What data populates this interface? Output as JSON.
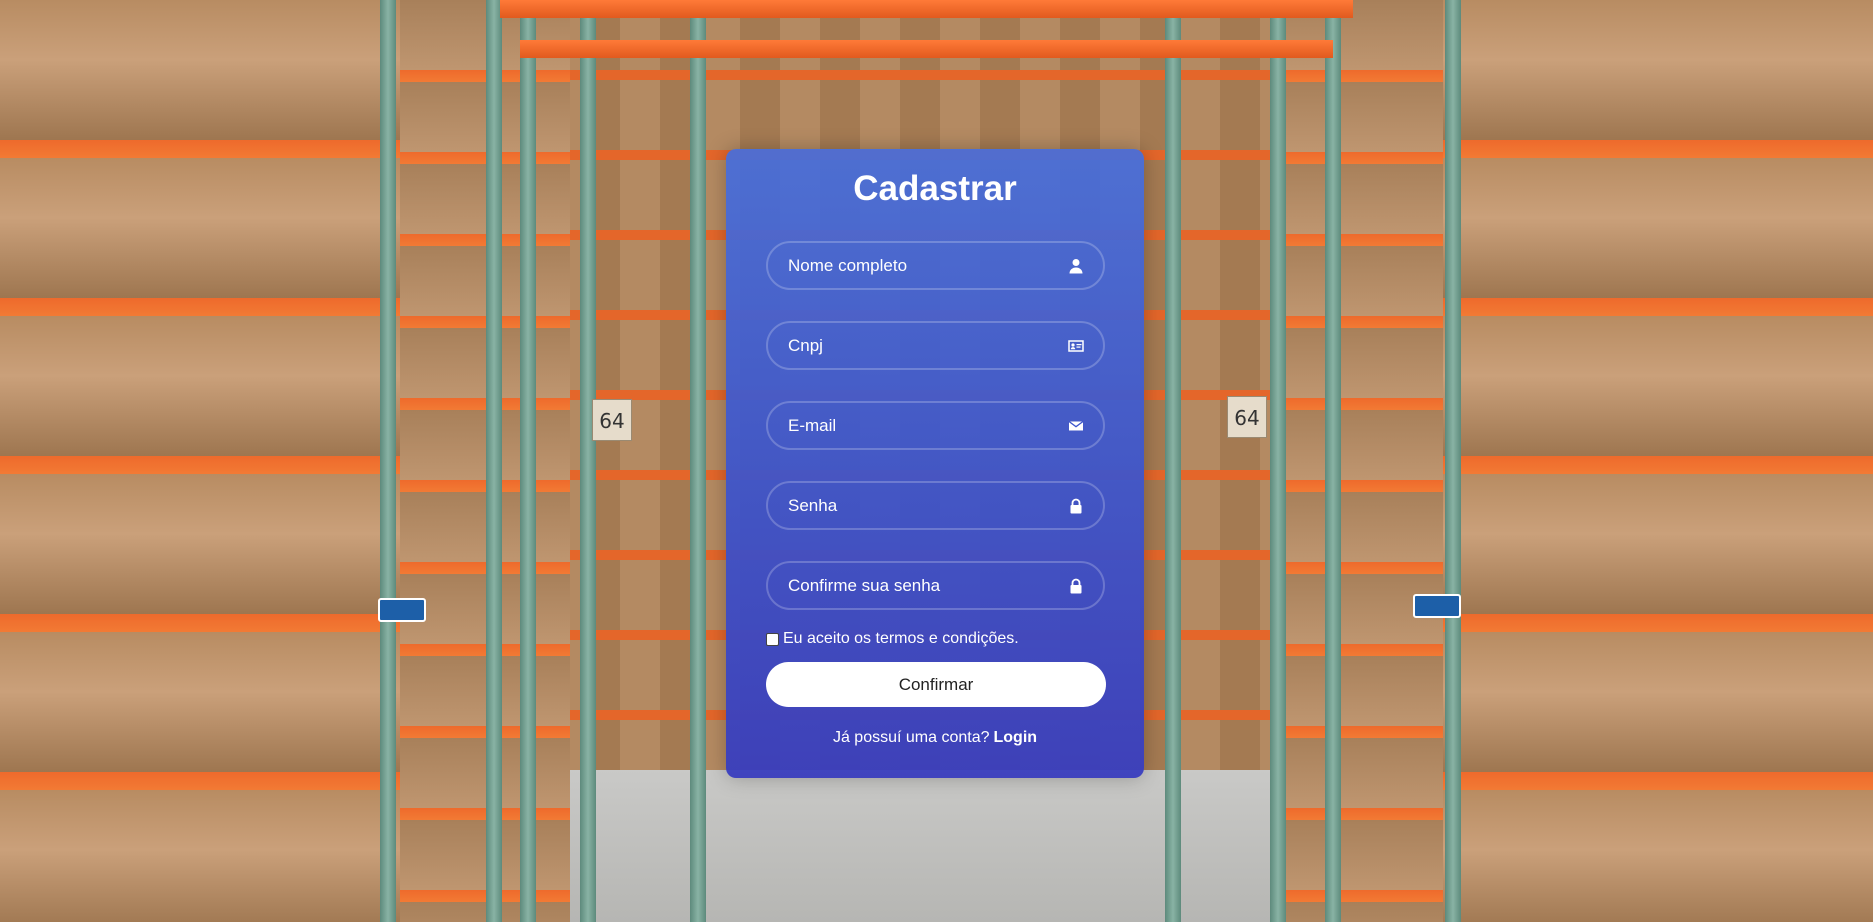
{
  "form": {
    "title": "Cadastrar",
    "fields": [
      {
        "placeholder": "Nome completo",
        "value": "",
        "icon": "user-icon"
      },
      {
        "placeholder": "Cnpj",
        "value": "",
        "icon": "id-card-icon"
      },
      {
        "placeholder": "E-mail",
        "value": "",
        "icon": "envelope-icon"
      },
      {
        "placeholder": "Senha",
        "value": "",
        "icon": "lock-icon"
      },
      {
        "placeholder": "Confirme sua senha",
        "value": "",
        "icon": "lock-icon"
      }
    ],
    "terms_label": "Eu aceito os termos e condições.",
    "terms_checked": false,
    "confirm_label": "Confirmar",
    "login_prompt": "Já possuí uma conta?",
    "login_link": "Login"
  },
  "background": {
    "aisle_numbers": [
      "64",
      "64"
    ]
  },
  "colors": {
    "card_top": "#466edc",
    "card_bottom": "#373cbe",
    "button_bg": "#ffffff",
    "text": "#ffffff",
    "shelf_orange": "#ee6a2c",
    "post_green": "#6a9a8a"
  }
}
